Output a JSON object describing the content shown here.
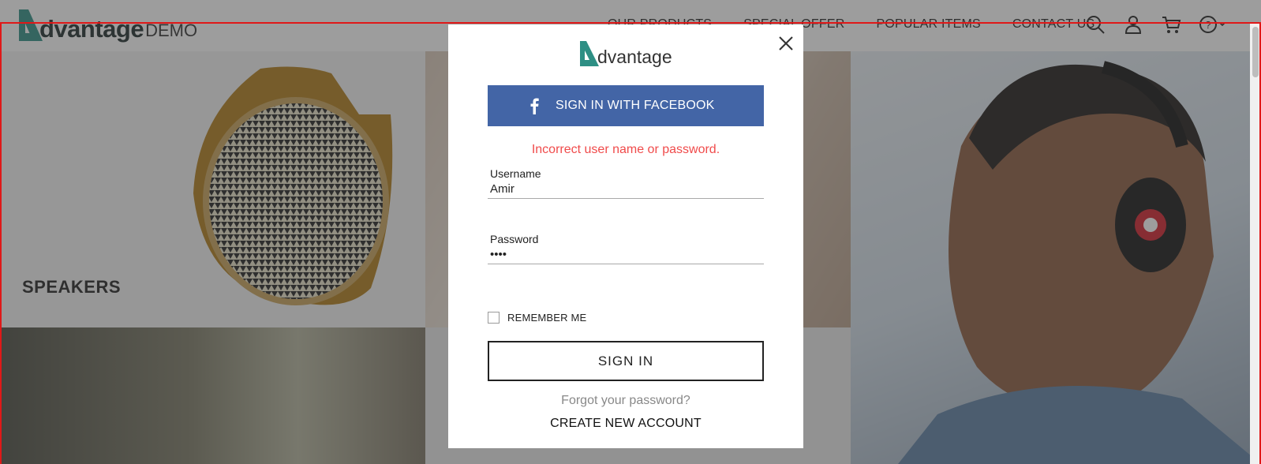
{
  "header": {
    "logo_word": "dvantage",
    "logo_suffix": "DEMO",
    "nav": [
      "OUR PRODUCTS",
      "SPECIAL OFFER",
      "POPULAR ITEMS",
      "CONTACT US"
    ],
    "icons": [
      "search-icon",
      "user-icon",
      "cart-icon",
      "help-icon"
    ]
  },
  "tiles": {
    "speakers_label": "SPEAKERS"
  },
  "modal": {
    "logo_word": "dvantage",
    "facebook_button": "SIGN IN WITH FACEBOOK",
    "error_message": "Incorrect user name or password.",
    "username": {
      "label": "Username",
      "value": "Amir"
    },
    "password": {
      "label": "Password",
      "value": "••••"
    },
    "remember_me": {
      "label": "REMEMBER ME",
      "checked": false
    },
    "sign_in_button": "SIGN IN",
    "forgot_password": "Forgot your password?",
    "create_account": "CREATE NEW ACCOUNT"
  },
  "colors": {
    "brand_teal": "#2e8f84",
    "facebook_blue": "#4365a6",
    "error_red": "#f04b4b",
    "frame_red": "#e01818"
  }
}
